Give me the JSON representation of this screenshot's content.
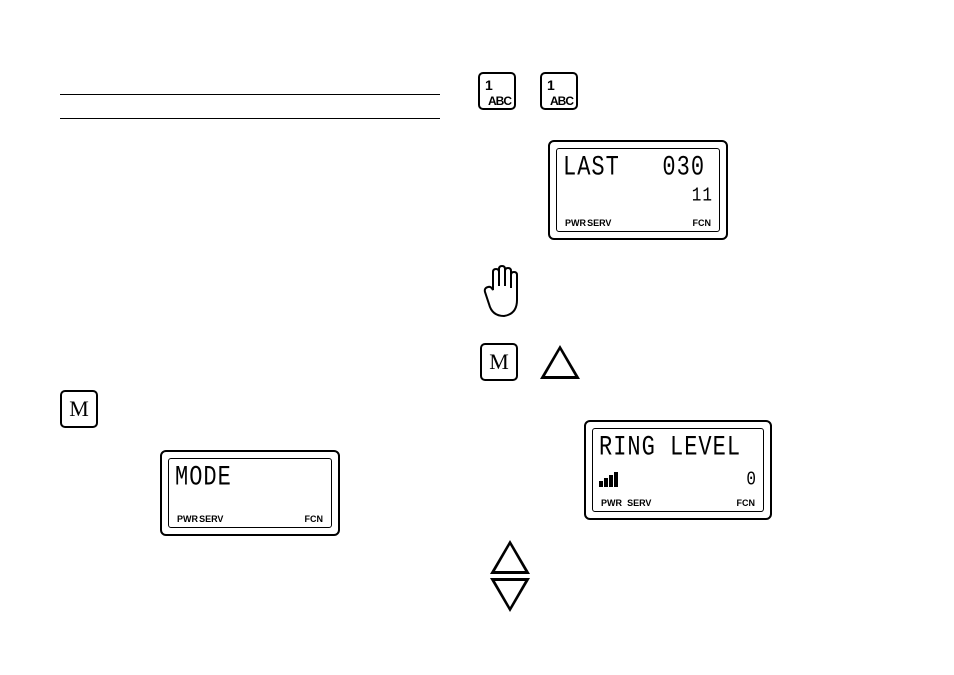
{
  "key1": {
    "top": "1",
    "bottom": "ABC"
  },
  "key2": {
    "top": "1",
    "bottom": "ABC"
  },
  "mkey": {
    "label": "M"
  },
  "lcd_last": {
    "line1": "LAST   030",
    "line2": "        11",
    "pwr": "PWR",
    "serv": "SERV",
    "fcn": "FCN"
  },
  "lcd_ring": {
    "line1": "RING LEVEL",
    "line2": "         0",
    "pwr": "PWR",
    "serv": "SERV",
    "fcn": "FCN"
  },
  "lcd_mode": {
    "line1": "MODE",
    "pwr": "PWR",
    "serv": "SERV",
    "fcn": "FCN"
  }
}
